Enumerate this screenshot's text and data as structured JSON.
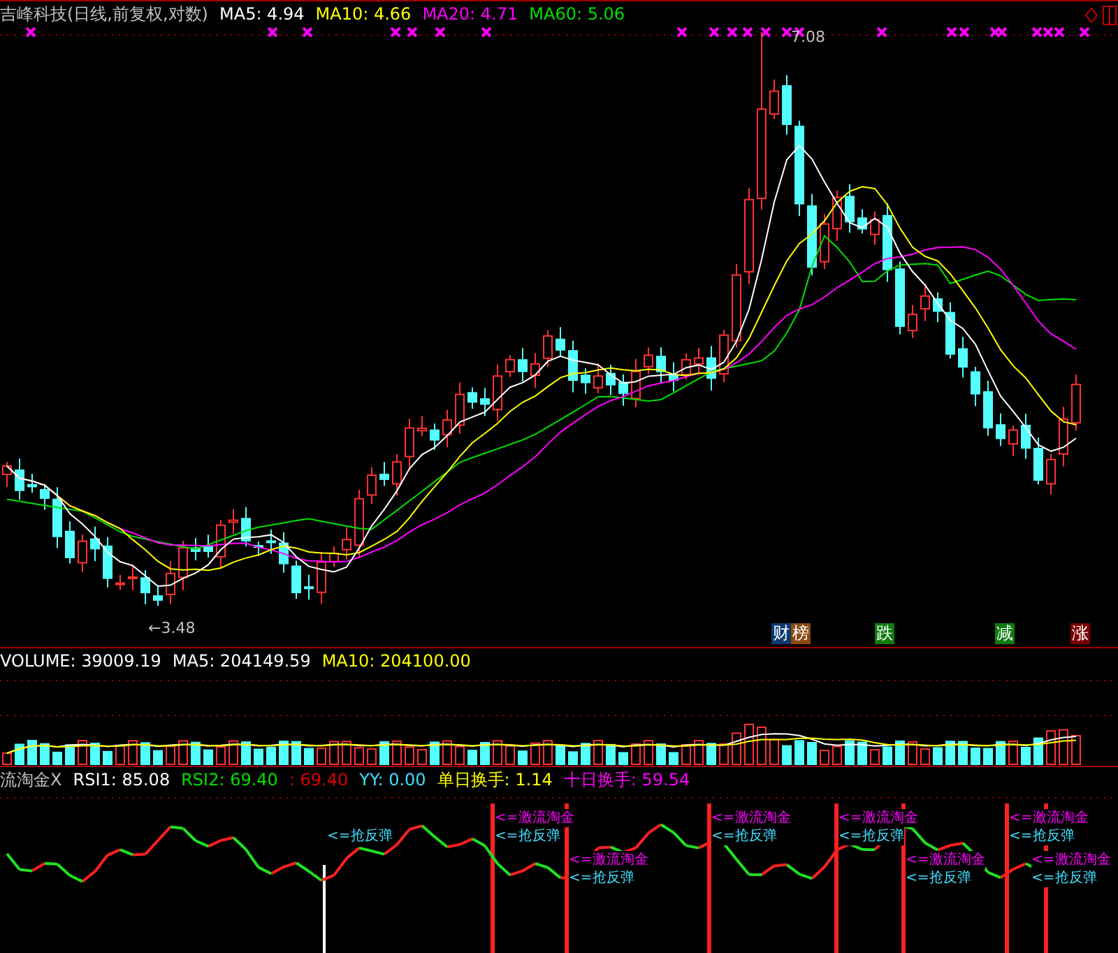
{
  "price_panel": {
    "title": "吉峰科技(日线,前复权,对数)",
    "legend": [
      {
        "label": "MA5: 4.94",
        "color": "#ffffff"
      },
      {
        "label": "MA10: 4.66",
        "color": "#ffff00"
      },
      {
        "label": "MA20: 4.71",
        "color": "#ff00ff"
      },
      {
        "label": "MA60: 5.06",
        "color": "#00e000"
      }
    ],
    "high_label": "7.08",
    "low_label": "←3.48",
    "badges": [
      {
        "text": "财",
        "color": "#0a3a6e"
      },
      {
        "text": "榜",
        "color": "#8a4a10"
      },
      {
        "text": "跌",
        "color": "#107a10"
      },
      {
        "text": "减",
        "color": "#107a10"
      },
      {
        "text": "涨",
        "color": "#7a0000"
      }
    ]
  },
  "volume_panel": {
    "legend": [
      {
        "label": "VOLUME: 39009.19",
        "color": "#ffffff"
      },
      {
        "label": "MA5: 204149.59",
        "color": "#ffffff"
      },
      {
        "label": "MA10: 204100.00",
        "color": "#ffff00"
      }
    ]
  },
  "indicator_panel": {
    "legend": [
      {
        "label": "流淘金X",
        "color": "#c0c0c0"
      },
      {
        "label": "RSI1: 85.08",
        "color": "#ffffff"
      },
      {
        "label": "RSI2: 69.40",
        "color": "#00e000"
      },
      {
        "label": ": 69.40",
        "color": "#e00000"
      },
      {
        "label": "YY: 0.00",
        "color": "#40e0ff"
      },
      {
        "label": "单日换手: 1.14",
        "color": "#ffff00"
      },
      {
        "label": "十日换手: 59.54",
        "color": "#ff00ff"
      }
    ],
    "signals": [
      {
        "kind": "rebound",
        "tags": [
          {
            "text": "<=抢反弹",
            "color": "#40e0ff"
          }
        ]
      },
      {
        "kind": "surge",
        "tags": [
          {
            "text": "<=激流淘金",
            "color": "#ff00ff"
          },
          {
            "text": "<=抢反弹",
            "color": "#40e0ff"
          }
        ]
      },
      {
        "kind": "surge",
        "tags": [
          {
            "text": "<=激流淘金",
            "color": "#ff00ff"
          },
          {
            "text": "<=抢反弹",
            "color": "#40e0ff"
          }
        ]
      },
      {
        "kind": "surge",
        "tags": [
          {
            "text": "<=激流淘金",
            "color": "#ff00ff"
          },
          {
            "text": "<=抢反弹",
            "color": "#40e0ff"
          }
        ]
      },
      {
        "kind": "surge",
        "tags": [
          {
            "text": "<=激流淘金",
            "color": "#ff00ff"
          },
          {
            "text": "<=抢反弹",
            "color": "#40e0ff"
          }
        ]
      },
      {
        "kind": "surge",
        "tags": [
          {
            "text": "<=激流淘金",
            "color": "#ff00ff"
          },
          {
            "text": "<=抢反弹",
            "color": "#40e0ff"
          }
        ]
      },
      {
        "kind": "surge",
        "tags": [
          {
            "text": "<=激流淘金",
            "color": "#ff00ff"
          },
          {
            "text": "<=抢反弹",
            "color": "#40e0ff"
          }
        ]
      },
      {
        "kind": "surge",
        "tags": [
          {
            "text": "<=激流淘金",
            "color": "#ff00ff"
          },
          {
            "text": "<=抢反弹",
            "color": "#40e0ff"
          }
        ]
      }
    ]
  }
}
